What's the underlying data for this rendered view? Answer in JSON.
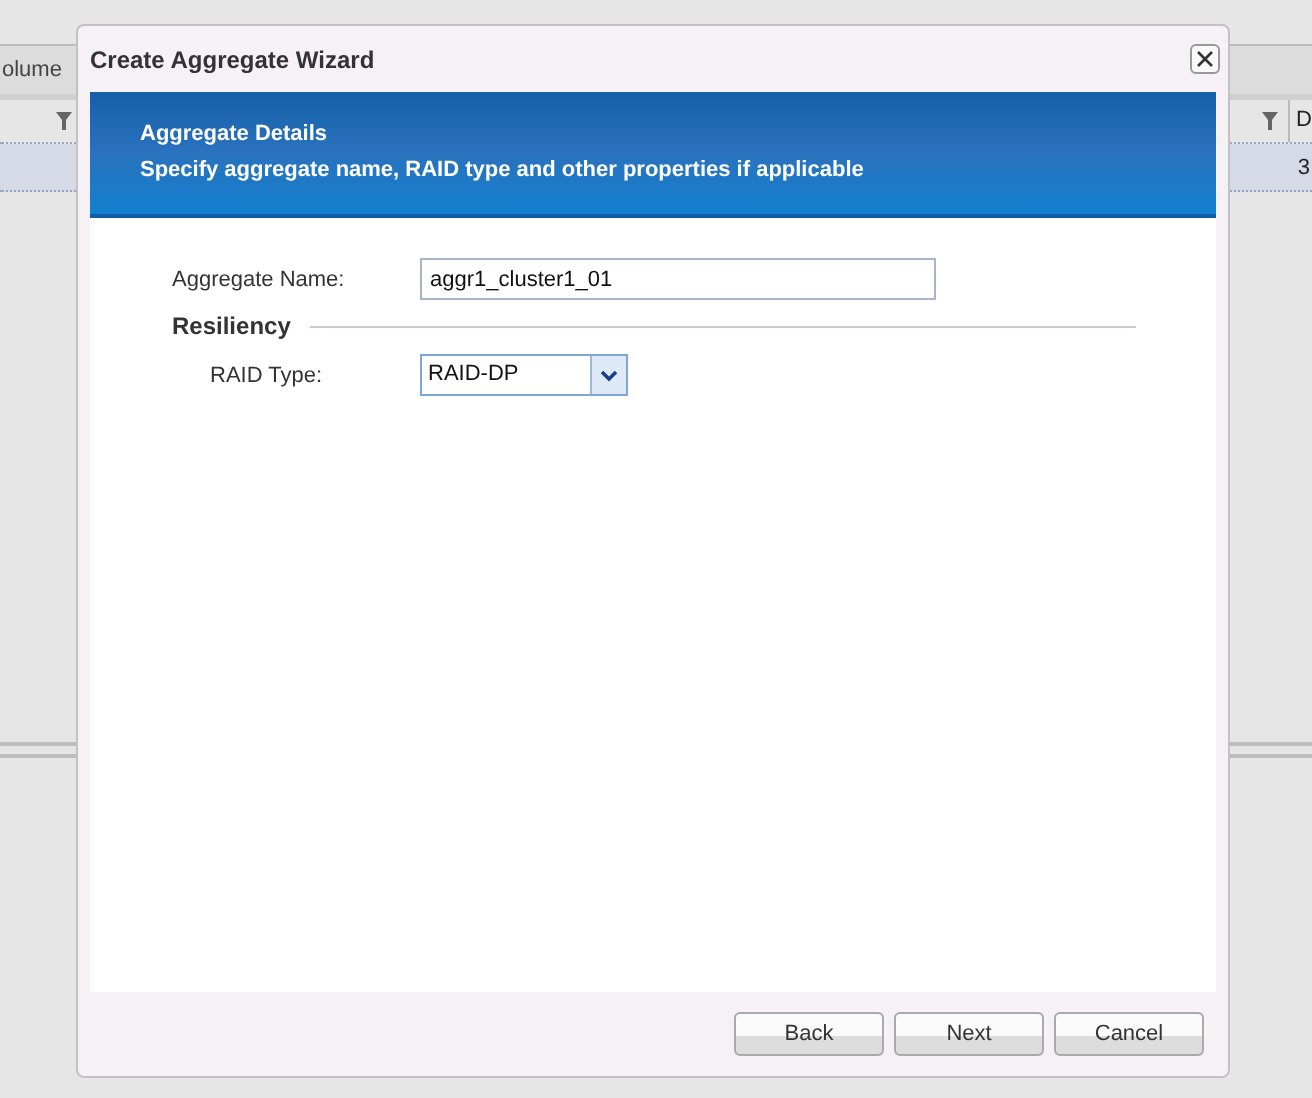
{
  "background": {
    "tab_label": "olume",
    "column_3_heading": "D",
    "row": {
      "selected": true,
      "column_3": "3"
    }
  },
  "dialog": {
    "title": "Create Aggregate Wizard",
    "banner": {
      "title": "Aggregate Details",
      "subtitle": "Specify aggregate name, RAID type and other properties if applicable"
    },
    "fields": [
      {
        "kind": "text",
        "label": "Aggregate Name:",
        "value": "aggr1_cluster1_01"
      }
    ],
    "sections": [
      {
        "title": "Resiliency",
        "fields": [
          {
            "kind": "select",
            "label": "RAID Type:",
            "value": "RAID-DP"
          }
        ]
      }
    ],
    "buttons": [
      "Back",
      "Next",
      "Cancel"
    ]
  }
}
